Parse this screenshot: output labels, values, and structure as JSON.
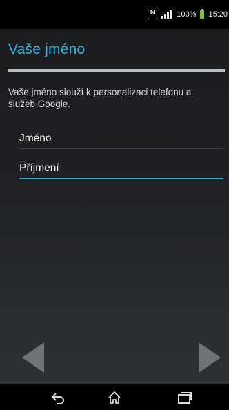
{
  "status_bar": {
    "battery_percent": "100%",
    "time": "15:20",
    "icons": [
      "nfc-icon",
      "signal-icon",
      "battery-icon"
    ],
    "battery_color": "#79c63b"
  },
  "header": {
    "title": "Vaše jméno",
    "title_color": "#2db8e4"
  },
  "description": "Vaše jméno slouží k personalizaci telefonu a služeb Google.",
  "form": {
    "first_name_placeholder": "Jméno",
    "last_name_placeholder": "Příjmení",
    "focus_color": "#2ea7d4"
  },
  "navigation": {
    "back_icon": "back-arrow-icon",
    "next_icon": "next-arrow-icon"
  },
  "system_bar": {
    "buttons": [
      "back-icon",
      "home-icon",
      "recent-apps-icon"
    ]
  }
}
